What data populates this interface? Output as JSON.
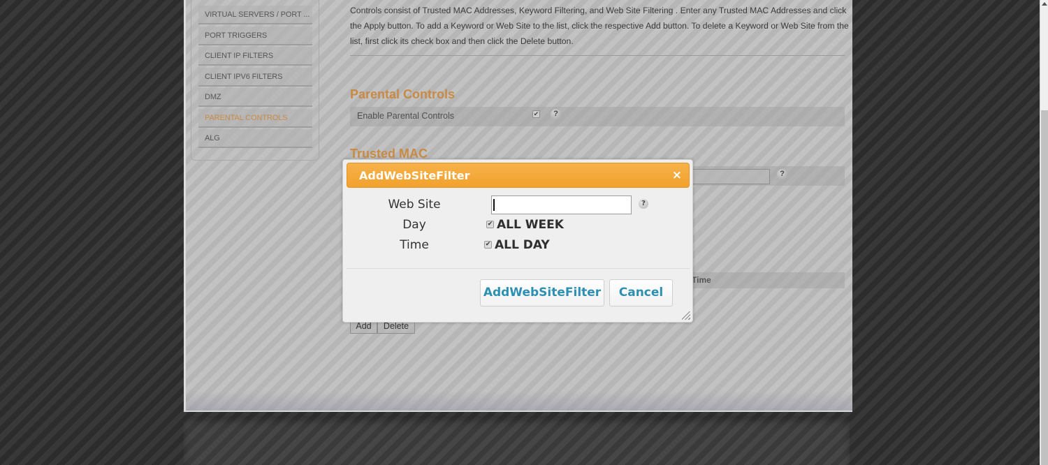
{
  "sidebar": {
    "items": [
      {
        "label": "VIRTUAL SERVERS / PORT ...",
        "active": false
      },
      {
        "label": "PORT TRIGGERS",
        "active": false
      },
      {
        "label": "CLIENT IP FILTERS",
        "active": false
      },
      {
        "label": "CLIENT IPV6 FILTERS",
        "active": false
      },
      {
        "label": "DMZ",
        "active": false
      },
      {
        "label": "PARENTAL CONTROLS",
        "active": true
      },
      {
        "label": "ALG",
        "active": false
      }
    ]
  },
  "main": {
    "description": "Controls consist of Trusted MAC Addresses, Keyword Filtering, and Web Site Filtering . Enter any Trusted MAC Addresses and click the Apply button. To add a Keyword or Web Site to the list, click the respective Add button. To delete a Keyword or Web Site from the list, first click its check box and then click the Delete button.",
    "parental_controls": {
      "title": "Parental Controls",
      "enable_label": "Enable Parental Controls",
      "enable_checked": true
    },
    "trusted_mac": {
      "title": "Trusted MAC",
      "mac_value": ""
    },
    "website_table": {
      "time_header": "Time"
    },
    "add_label": "Add",
    "delete_label": "Delete",
    "help_glyph": "?",
    "check_glyph": "✔"
  },
  "dialog": {
    "title": "AddWebSiteFilter",
    "close_glyph": "×",
    "web_site_label": "Web Site",
    "web_site_value": "",
    "day_label": "Day",
    "day_option": "ALL WEEK",
    "day_checked": true,
    "time_label": "Time",
    "time_option": "ALL DAY",
    "time_checked": true,
    "help_glyph": "?",
    "submit_label": "AddWebSiteFilter",
    "cancel_label": "Cancel"
  },
  "colors": {
    "accent_orange": "#c98a44",
    "dialog_title_bg": "#f2a12d",
    "dialog_button_text": "#2d8fb2"
  }
}
